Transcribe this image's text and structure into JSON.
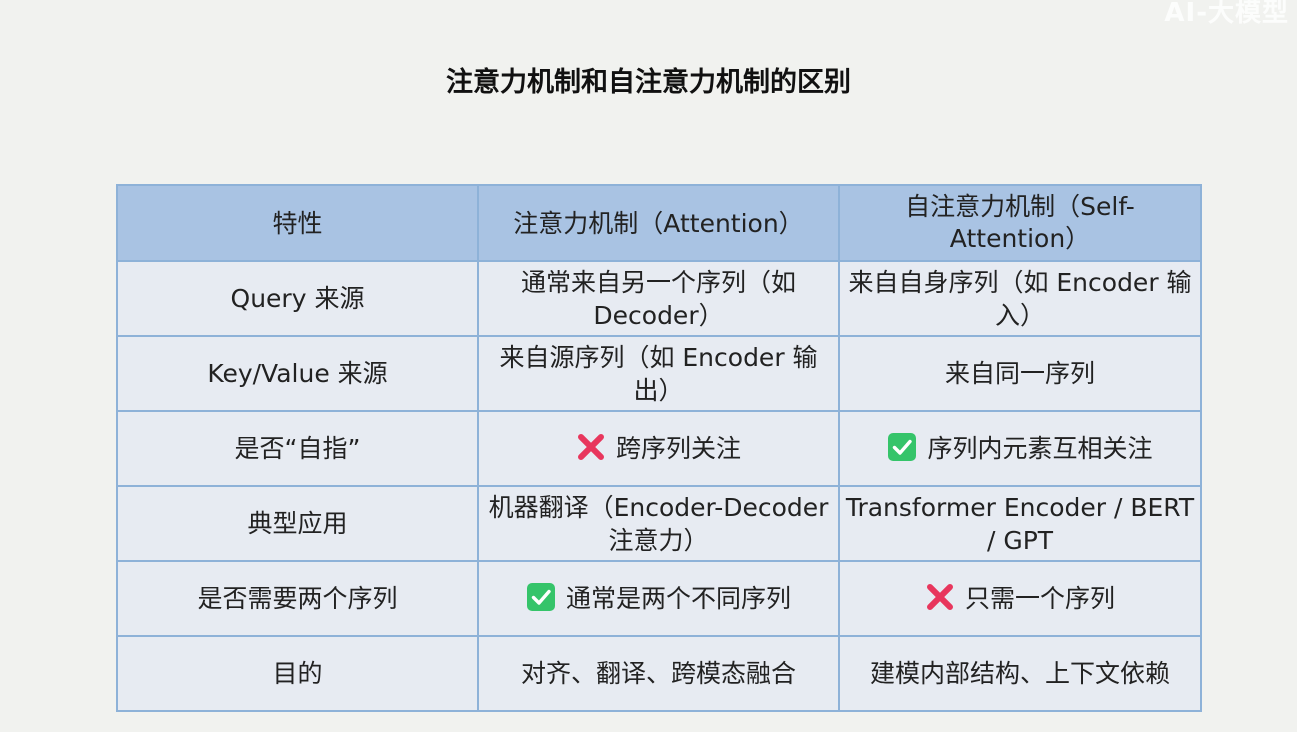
{
  "watermark": "AI-大模型",
  "title": "注意力机制和自注意力机制的区别",
  "colors": {
    "header_bg": "#a9c3e3",
    "cell_bg": "#e7ebf2",
    "border": "#8eb2d8",
    "cross": "#e8365d",
    "check": "#35c46a"
  },
  "table": {
    "headers": [
      "特性",
      "注意力机制（Attention）",
      "自注意力机制（Self-Attention）"
    ],
    "rows": [
      {
        "feature": "Query 来源",
        "attention": "通常来自另一个序列（如 Decoder）",
        "self_attention": "来自自身序列（如 Encoder 输入）"
      },
      {
        "feature": "Key/Value 来源",
        "attention": "来自源序列（如 Encoder 输出）",
        "self_attention": "来自同一序列"
      },
      {
        "feature": "是否“自指”",
        "attention": "跨序列关注",
        "attention_icon": "cross-mark-icon",
        "self_attention": "序列内元素互相关注",
        "self_attention_icon": "check-mark-icon"
      },
      {
        "feature": "典型应用",
        "attention": "机器翻译（Encoder-Decoder 注意力）",
        "self_attention": "Transformer Encoder / BERT / GPT"
      },
      {
        "feature": "是否需要两个序列",
        "attention": "通常是两个不同序列",
        "attention_icon": "check-mark-icon",
        "self_attention": "只需一个序列",
        "self_attention_icon": "cross-mark-icon"
      },
      {
        "feature": "目的",
        "attention": "对齐、翻译、跨模态融合",
        "self_attention": "建模内部结构、上下文依赖"
      }
    ]
  }
}
